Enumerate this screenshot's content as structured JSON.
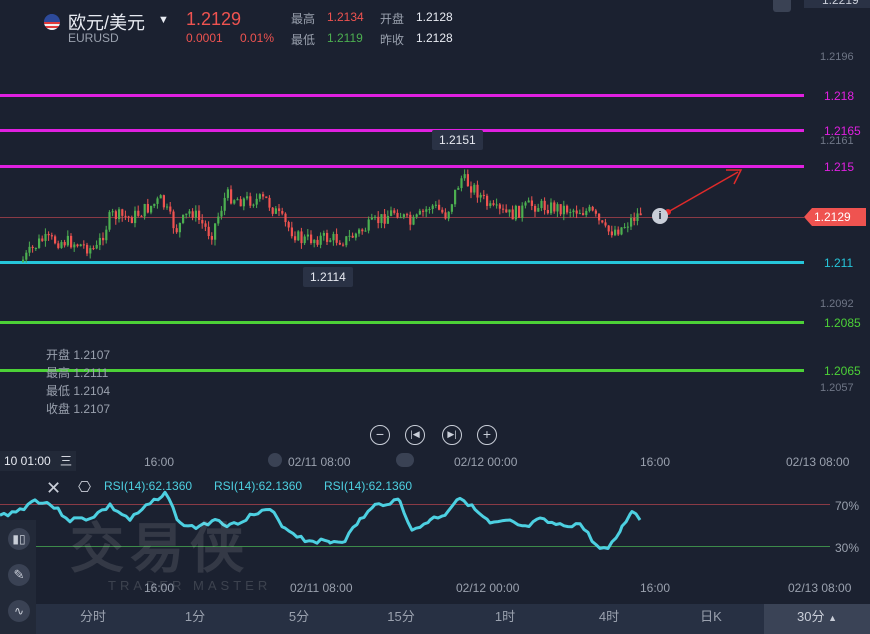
{
  "header": {
    "pair_name": "欧元/美元",
    "symbol": "EURUSD",
    "price": "1.2129",
    "change": "0.0001",
    "change_pct": "0.01%",
    "high_label": "最高",
    "high_value": "1.2134",
    "low_label": "最低",
    "low_value": "1.2119",
    "open_label": "开盘",
    "open_value": "1.2128",
    "prev_close_label": "昨收",
    "prev_close_value": "1.2128"
  },
  "price_axis": {
    "ticks": [
      "1.2219",
      "1.2196",
      "1.2161",
      "1.2092",
      "1.2057"
    ],
    "current_tag": "1.2129"
  },
  "levels": [
    {
      "value": "1.218",
      "color": "#e020e0"
    },
    {
      "value": "1.2165",
      "color": "#e020e0"
    },
    {
      "value": "1.215",
      "color": "#e020e0"
    },
    {
      "value": "1.211",
      "color": "#26c6da"
    },
    {
      "value": "1.2085",
      "color": "#4cd137"
    },
    {
      "value": "1.2065",
      "color": "#4cd137"
    }
  ],
  "markers": {
    "high": "1.2151",
    "low": "1.2114"
  },
  "ohlc_panel": {
    "open": "开盘 1.2107",
    "high": "最高 1.2111",
    "low": "最低 1.2104",
    "close": "收盘 1.2107"
  },
  "time_axis": {
    "crosshair_time": "10 01:00",
    "menu_glyph": "三",
    "labels": [
      "16:00",
      "02/11 08:00",
      "02/12 00:00",
      "16:00",
      "02/13 08:00"
    ],
    "bottom_labels": [
      "16:00",
      "02/11 08:00",
      "02/12 00:00",
      "16:00",
      "02/13 08:00"
    ]
  },
  "rsi": {
    "labels": [
      "RSI(14):62.1360",
      "RSI(14):62.1360",
      "RSI(14):62.1360"
    ],
    "level_high": "70%",
    "level_low": "30%"
  },
  "watermark": {
    "cn": "交易侠",
    "en": "TRADER MASTER"
  },
  "timeframes": [
    "分时",
    "1分",
    "5分",
    "15分",
    "1时",
    "4时",
    "日K",
    "30分"
  ],
  "selected_timeframe": "30分",
  "colors": {
    "up": "#4caf50",
    "down": "#ef5350",
    "rsi_line": "#4dd0e1",
    "background": "#1b2130"
  },
  "icons": {
    "zoom_out": "minus-circle-icon",
    "prev": "skip-back-icon",
    "next": "skip-forward-icon",
    "zoom_in": "plus-circle-icon"
  }
}
